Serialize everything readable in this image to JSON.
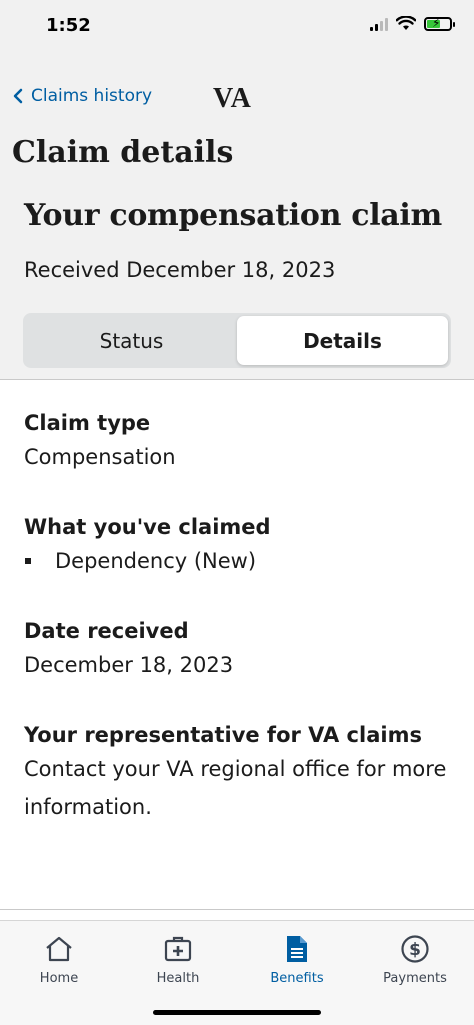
{
  "status_bar": {
    "time": "1:52"
  },
  "nav": {
    "back_label": "Claims history",
    "logo": "VA"
  },
  "screen_title": "Claim details",
  "claim": {
    "heading": "Your compensation claim",
    "received": "Received December 18, 2023"
  },
  "segments": [
    {
      "label": "Status",
      "selected": false
    },
    {
      "label": "Details",
      "selected": true
    }
  ],
  "details": {
    "claim_type": {
      "label": "Claim type",
      "value": "Compensation"
    },
    "claimed": {
      "label": "What you've claimed",
      "items": [
        "Dependency (New)"
      ]
    },
    "date_received": {
      "label": "Date received",
      "value": "December 18, 2023"
    },
    "representative": {
      "label": "Your representative for VA claims",
      "value": "Contact your VA regional office for more information."
    }
  },
  "tabbar": {
    "items": [
      {
        "label": "Home",
        "icon": "home-icon"
      },
      {
        "label": "Health",
        "icon": "medical-kit-icon"
      },
      {
        "label": "Benefits",
        "icon": "document-icon",
        "active": true
      },
      {
        "label": "Payments",
        "icon": "dollar-circle-icon"
      }
    ]
  },
  "colors": {
    "accent": "#005ea2",
    "background": "#f1f1f1",
    "text": "#1b1b1b"
  }
}
